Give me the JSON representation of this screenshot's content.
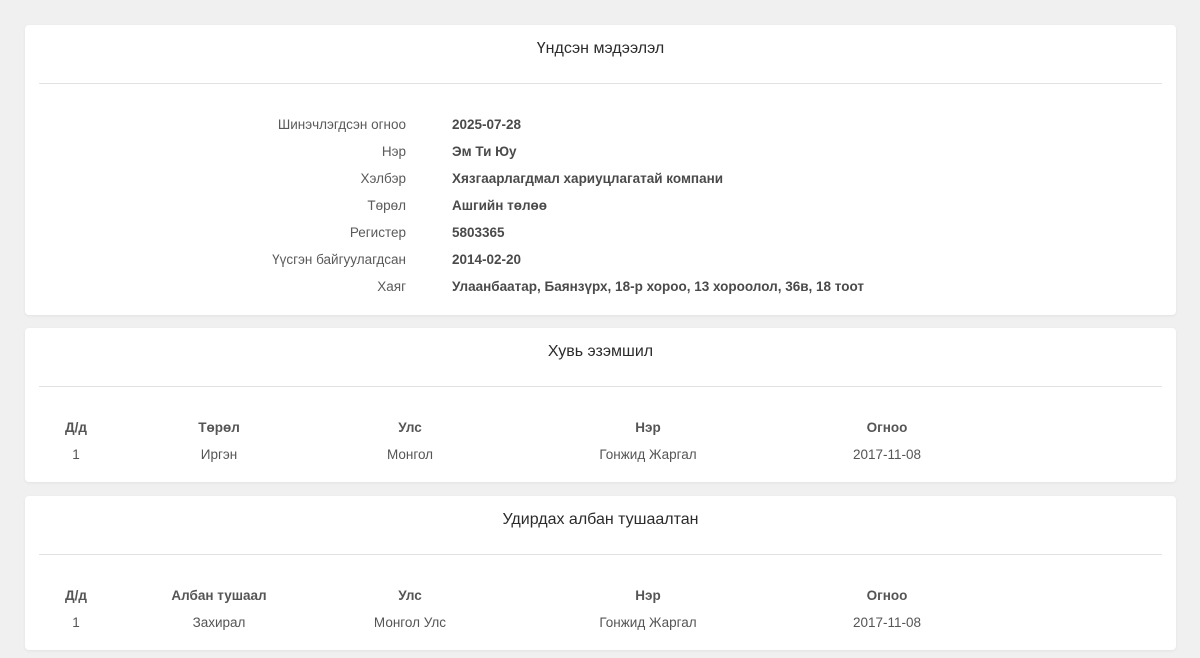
{
  "basic": {
    "title": "Үндсэн мэдээлэл",
    "rows": [
      {
        "label": "Шинэчлэгдсэн огноо",
        "value": "2025-07-28"
      },
      {
        "label": "Нэр",
        "value": "Эм Ти Юу"
      },
      {
        "label": "Хэлбэр",
        "value": "Хязгаарлагдмал хариуцлагатай компани"
      },
      {
        "label": "Төрөл",
        "value": "Ашгийн төлөө"
      },
      {
        "label": "Регистер",
        "value": "5803365"
      },
      {
        "label": "Үүсгэн байгуулагдсан",
        "value": "2014-02-20"
      },
      {
        "label": "Хаяг",
        "value": "Улаанбаатар, Баянзүрх, 18-р хороо, 13 хороолол, 36в, 18 тоот"
      }
    ]
  },
  "ownership": {
    "title": "Хувь эзэмшил",
    "columns": [
      "Д/д",
      "Төрөл",
      "Улс",
      "Нэр",
      "Огноо"
    ],
    "rows": [
      [
        "1",
        "Иргэн",
        "Монгол",
        "Гонжид Жаргал",
        "2017-11-08"
      ]
    ]
  },
  "management": {
    "title": "Удирдах албан тушаалтан",
    "columns": [
      "Д/д",
      "Албан тушаал",
      "Улс",
      "Нэр",
      "Огноо"
    ],
    "rows": [
      [
        "1",
        "Захирал",
        "Монгол Улс",
        "Гонжид Жаргал",
        "2017-11-08"
      ]
    ]
  }
}
